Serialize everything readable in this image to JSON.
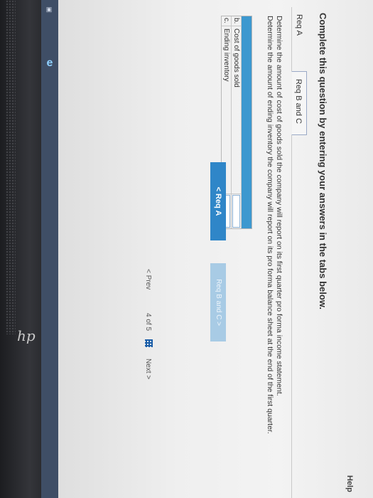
{
  "header": {
    "help_label": "Help"
  },
  "question": {
    "title": "Complete this question by entering your answers in the tabs below."
  },
  "tabs": [
    {
      "label": "Req A"
    },
    {
      "label": "Req B and C"
    }
  ],
  "instructions": {
    "line1": "Determine the amount of cost of goods sold the company will report on its first quarter pro forma income statement.",
    "line2": "Determine the amount of ending inventory the company will report on its pro forma balance sheet at the end of the first quarter."
  },
  "table": {
    "rows": [
      {
        "letter": "b.",
        "label": "Cost of goods sold",
        "value": ""
      },
      {
        "letter": "c.",
        "label": "Ending inventory",
        "value": ""
      }
    ]
  },
  "nav_buttons": {
    "prev_label": "< Req A",
    "next_label": "Req B and C >"
  },
  "pager": {
    "prev_label": "< Prev",
    "page_text": "4 of 5",
    "next_label": "Next >"
  },
  "taskbar": {
    "brand": "hp"
  }
}
